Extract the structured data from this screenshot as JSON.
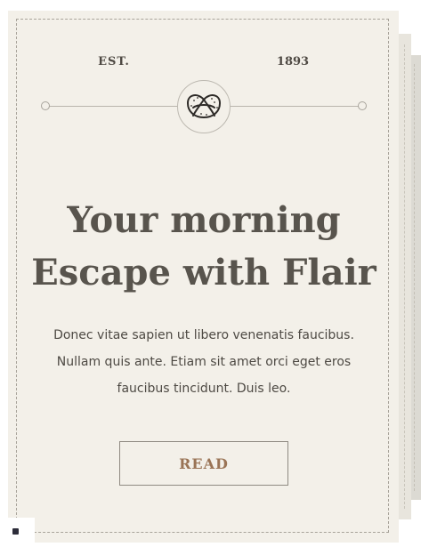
{
  "card": {
    "est_label": "EST.",
    "year_label": "1893",
    "logo_icon": "pretzel-icon",
    "headline_line1": "Your morning",
    "headline_line2": "Escape with Flair",
    "body": "Donec vitae sapien ut libero venenatis faucibus. Nullam quis ante. Etiam sit amet orci eget eros faucibus tincidunt. Duis leo.",
    "button_label": "READ"
  },
  "corner_widget": {
    "icon": "square-icon"
  },
  "colors": {
    "card_background": "#f3f0e9",
    "headline": "#58544d",
    "button_text": "#9a7456",
    "stack_mid": "#e8e5dd",
    "stack_back": "#dcdad3"
  }
}
